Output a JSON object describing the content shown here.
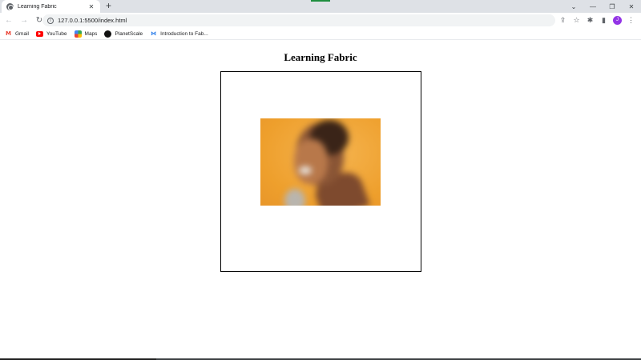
{
  "browser": {
    "tab": {
      "title": "Learning Fabric",
      "close": "✕"
    },
    "new_tab": "+",
    "window_controls": {
      "dropdown": "⌄",
      "minimize": "—",
      "restore": "❐",
      "close": "✕"
    },
    "nav": {
      "back": "←",
      "forward": "→",
      "reload": "↻"
    },
    "url": "127.0.0.1:5500/index.html",
    "toolbar_icons": {
      "share": "⇪",
      "star": "☆",
      "extensions": "✱",
      "sidepanel": "▮",
      "menu": "⋮"
    },
    "avatar_initial": "J",
    "bookmarks": [
      {
        "label": "Gmail",
        "icon": "gmail-icon"
      },
      {
        "label": "YouTube",
        "icon": "youtube-icon"
      },
      {
        "label": "Maps",
        "icon": "maps-icon"
      },
      {
        "label": "PlanetScale",
        "icon": "planetscale-icon"
      },
      {
        "label": "Introduction to Fab...",
        "icon": "intro-icon"
      }
    ]
  },
  "page": {
    "title": "Learning Fabric"
  },
  "colors": {
    "accent": "#1e8e3e",
    "photo_background": "#ee9f2c",
    "avatar": "#9334e6"
  }
}
